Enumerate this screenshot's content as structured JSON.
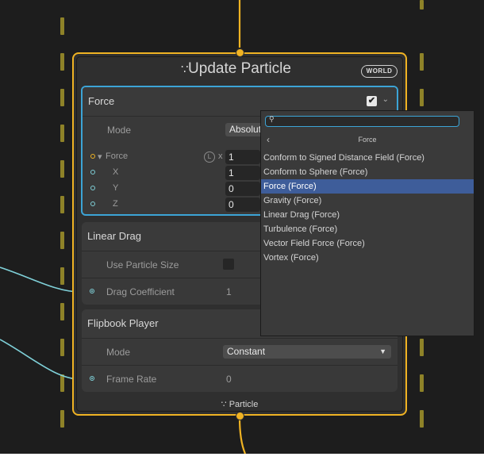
{
  "node": {
    "title": "Update Particle",
    "badge": "WORLD",
    "footer": "Particle",
    "accent_color": "#f0b323",
    "selection_color": "#3ca4d6",
    "wire_color": "#7fd0d8"
  },
  "force_block": {
    "title": "Force",
    "enabled_check": "✔",
    "mode_label": "Mode",
    "mode_value": "Absolute",
    "force_label": "Force",
    "space_badge": "L",
    "x_prefix": "x",
    "force_value": "1",
    "x_label": "X",
    "x_value": "1",
    "y_label": "Y",
    "y_value": "0",
    "z_label": "Z",
    "z_value": "0"
  },
  "linear_drag": {
    "title": "Linear Drag",
    "use_particle_size_label": "Use Particle Size",
    "drag_coefficient_label": "Drag Coefficient",
    "drag_coefficient_value": "1"
  },
  "flipbook": {
    "title": "Flipbook Player",
    "mode_label": "Mode",
    "mode_value": "Constant",
    "frame_rate_label": "Frame Rate",
    "frame_rate_value": "0"
  },
  "dropdown": {
    "search_value": "",
    "category": "Force",
    "items": [
      "Conform to Signed Distance Field (Force)",
      "Conform to Sphere (Force)",
      "Force (Force)",
      "Gravity (Force)",
      "Linear Drag (Force)",
      "Turbulence (Force)",
      "Vector Field Force (Force)",
      "Vortex (Force)"
    ],
    "selected_index": 2
  }
}
